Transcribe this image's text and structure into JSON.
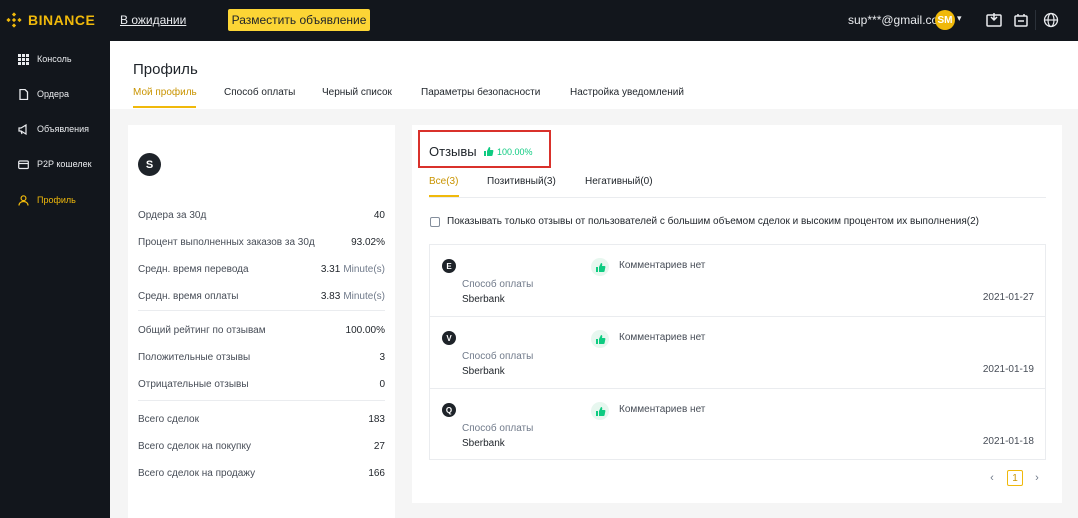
{
  "topbar": {
    "logo_text": "BINANCE",
    "pending_link": "В ожидании",
    "post_ad_button": "Разместить объявление",
    "user_email": "sup***@gmail.com",
    "avatar_initials": "SM"
  },
  "sidebar": {
    "items": [
      {
        "label": "Консоль",
        "icon": "grid-icon"
      },
      {
        "label": "Ордера",
        "icon": "document-icon"
      },
      {
        "label": "Объявления",
        "icon": "megaphone-icon"
      },
      {
        "label": "P2P кошелек",
        "icon": "wallet-icon"
      },
      {
        "label": "Профиль",
        "icon": "user-icon"
      }
    ],
    "active_index": 4
  },
  "header": {
    "title": "Профиль",
    "tabs": [
      "Мой профиль",
      "Способ оплаты",
      "Черный список",
      "Параметры безопасности",
      "Настройка уведомлений"
    ],
    "active_tab": 0
  },
  "profile": {
    "avatar_letter": "S",
    "stats": {
      "orders_30d": {
        "label": "Ордера за 30д",
        "value": "40"
      },
      "completion_30d": {
        "label": "Процент выполненных заказов за 30д",
        "value": "93.02%"
      },
      "avg_transfer": {
        "label": "Средн. время перевода",
        "value": "3.31",
        "unit": "Minute(s)"
      },
      "avg_payment": {
        "label": "Средн. время оплаты",
        "value": "3.83",
        "unit": "Minute(s)"
      },
      "overall_rating": {
        "label": "Общий рейтинг по отзывам",
        "value": "100.00%"
      },
      "positive": {
        "label": "Положительные отзывы",
        "value": "3"
      },
      "negative": {
        "label": "Отрицательные отзывы",
        "value": "0"
      },
      "total_trades": {
        "label": "Всего сделок",
        "value": "183"
      },
      "total_buy": {
        "label": "Всего сделок на покупку",
        "value": "27"
      },
      "total_sell": {
        "label": "Всего сделок на продажу",
        "value": "166"
      }
    }
  },
  "reviews": {
    "title": "Отзывы",
    "rate": "100.00%",
    "tabs": [
      "Все(3)",
      "Позитивный(3)",
      "Негативный(0)"
    ],
    "active_tab": 0,
    "filter_label": "Показывать только отзывы от пользователей с большим объемом сделок и высоким процентом их выполнения(2)",
    "filter_checked": false,
    "items": [
      {
        "avatar": "E",
        "payment_label": "Способ оплаты",
        "payment_method": "Sberbank",
        "comment": "Комментариев нет",
        "date": "2021-01-27"
      },
      {
        "avatar": "V",
        "payment_label": "Способ оплаты",
        "payment_method": "Sberbank",
        "comment": "Комментариев нет",
        "date": "2021-01-19"
      },
      {
        "avatar": "Q",
        "payment_label": "Способ оплаты",
        "payment_method": "Sberbank",
        "comment": "Комментариев нет",
        "date": "2021-01-18"
      }
    ],
    "pagination": {
      "current_page": "1",
      "prev": "‹",
      "next": "›"
    }
  },
  "colors": {
    "brand": "#f0b90b",
    "positive": "#0ecb81",
    "highlight_box": "#d9312b"
  }
}
